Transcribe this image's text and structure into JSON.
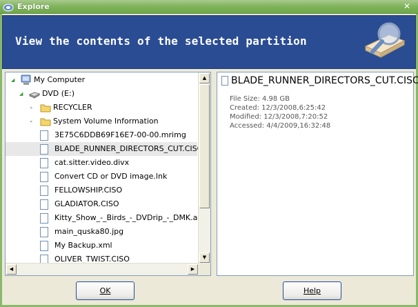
{
  "window": {
    "title": "Explore"
  },
  "banner": {
    "text": "View the contents of the selected partition"
  },
  "tree": {
    "items": [
      {
        "label": "My Computer",
        "kind": "computer",
        "depth": 0,
        "expanded": true
      },
      {
        "label": "DVD (E:)",
        "kind": "drive",
        "depth": 1,
        "expanded": true
      },
      {
        "label": "RECYCLER",
        "kind": "folder",
        "depth": 2,
        "expanded": false
      },
      {
        "label": "System Volume Information",
        "kind": "folder",
        "depth": 2,
        "expanded": false
      },
      {
        "label": "3E75C6DDB69F16E7-00-00.mrimg",
        "kind": "file",
        "depth": 2
      },
      {
        "label": "BLADE_RUNNER_DIRECTORS_CUT.CISO",
        "kind": "file",
        "depth": 2,
        "selected": true
      },
      {
        "label": "cat.sitter.video.divx",
        "kind": "file",
        "depth": 2
      },
      {
        "label": "Convert CD or DVD image.lnk",
        "kind": "file",
        "depth": 2
      },
      {
        "label": "FELLOWSHIP.CISO",
        "kind": "file",
        "depth": 2
      },
      {
        "label": "GLADIATOR.CISO",
        "kind": "file",
        "depth": 2
      },
      {
        "label": "Kitty_Show_-_Birds_-_DVDrip_-_DMK.avi",
        "kind": "file",
        "depth": 2
      },
      {
        "label": "main_quska80.jpg",
        "kind": "file",
        "depth": 2
      },
      {
        "label": "My Backup.xml",
        "kind": "file",
        "depth": 2
      },
      {
        "label": "OLIVER_TWIST.CISO",
        "kind": "file",
        "depth": 2
      }
    ]
  },
  "details": {
    "name": "BLADE_RUNNER_DIRECTORS_CUT.CISO",
    "size": "File Size: 4.98 GB",
    "created": "Created: 12/3/2008,6:25:42",
    "modified": "Modified: 12/3/2008,7:20:52",
    "accessed": "Accessed: 4/4/2009,16:32:48"
  },
  "buttons": {
    "ok": "OK",
    "help": "Help"
  },
  "colors": {
    "banner": "#2a4c93",
    "titlebar": "#7fb35a",
    "selection": "#e8e8e8"
  }
}
